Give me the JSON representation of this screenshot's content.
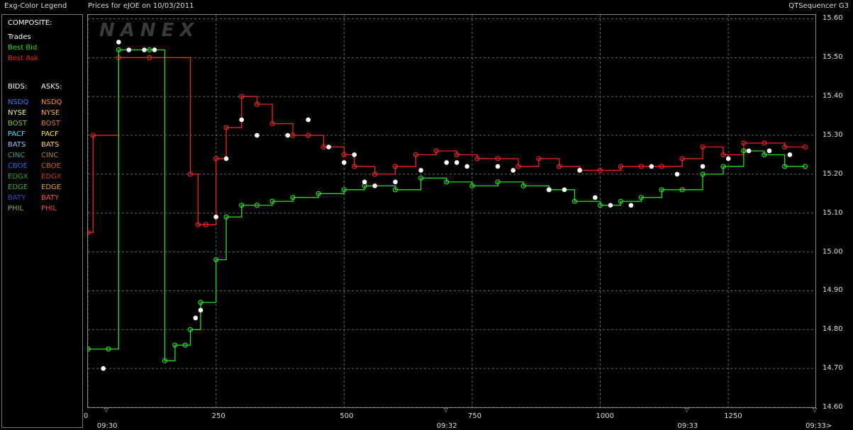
{
  "header": {
    "legend_title": "Exg-Color Legend",
    "chart_title": "Prices for  eJOE  on  10/03/2011",
    "app_name": "QTSequencer G3"
  },
  "legend": {
    "composite_label": "COMPOSITE:",
    "trades": "Trades",
    "best_bid": "Best Bid",
    "best_ask": "Best Ask",
    "bids_label": "BIDS:",
    "asks_label": "ASKS:",
    "exchanges": [
      {
        "name": "NSDQ",
        "bid_color": "#3a7bff",
        "ask_color": "#ff8c2a"
      },
      {
        "name": "NYSE",
        "bid_color": "#f4f4a0",
        "ask_color": "#ffb030"
      },
      {
        "name": "BOST",
        "bid_color": "#7cc84a",
        "ask_color": "#e07a3a"
      },
      {
        "name": "PACF",
        "bid_color": "#40e0ff",
        "ask_color": "#ffe040"
      },
      {
        "name": "BATS",
        "bid_color": "#a0c0ff",
        "ask_color": "#ffcc60"
      },
      {
        "name": "CINC",
        "bid_color": "#2aa0a0",
        "ask_color": "#b08030"
      },
      {
        "name": "CBOE",
        "bid_color": "#2070e0",
        "ask_color": "#d06020"
      },
      {
        "name": "EDGX",
        "bid_color": "#3a9a3a",
        "ask_color": "#c04010"
      },
      {
        "name": "EDGE",
        "bid_color": "#4aa04a",
        "ask_color": "#e0a020"
      },
      {
        "name": "BATY",
        "bid_color": "#3050c0",
        "ask_color": "#ff5050"
      },
      {
        "name": "PHIL",
        "bid_color": "#80b040",
        "ask_color": "#ff4040"
      }
    ]
  },
  "watermark": "NANEX",
  "colors": {
    "trades": "#ffffff",
    "best_bid": "#22dd22",
    "best_ask": "#ee2222",
    "grid": "#666666"
  },
  "chart_data": {
    "type": "line",
    "title": "Prices for  eJOE  on  10/03/2011",
    "x_label": "",
    "y_label": "",
    "xlim": [
      0,
      1420
    ],
    "ylim": [
      14.6,
      15.61
    ],
    "y_ticks": [
      "15.60",
      "15.50",
      "15.40",
      "15.30",
      "15.20",
      "15.10",
      "15.00",
      "14.90",
      "14.80",
      "14.70",
      "14.60"
    ],
    "x_ticks": [
      "0",
      "250",
      "500",
      "750",
      "1000",
      "1250"
    ],
    "time_ticks": [
      {
        "label": "09:30",
        "x": 37
      },
      {
        "label": "09:32",
        "x": 700
      },
      {
        "label": "09:33",
        "x": 1170
      },
      {
        "label": "09:33>",
        "x": 1420
      }
    ],
    "grid": true,
    "series": [
      {
        "name": "Best Ask",
        "x": [
          0,
          10,
          60,
          120,
          200,
          215,
          230,
          250,
          270,
          300,
          330,
          360,
          400,
          430,
          460,
          500,
          520,
          560,
          600,
          640,
          680,
          720,
          760,
          800,
          840,
          880,
          920,
          960,
          1000,
          1040,
          1080,
          1120,
          1160,
          1200,
          1240,
          1280,
          1320,
          1360,
          1400
        ],
        "y": [
          15.05,
          15.3,
          15.5,
          15.5,
          15.2,
          15.07,
          15.07,
          15.24,
          15.32,
          15.4,
          15.38,
          15.33,
          15.3,
          15.3,
          15.27,
          15.25,
          15.22,
          15.2,
          15.22,
          15.25,
          15.26,
          15.25,
          15.24,
          15.24,
          15.22,
          15.24,
          15.22,
          15.21,
          15.21,
          15.22,
          15.22,
          15.22,
          15.24,
          15.27,
          15.25,
          15.28,
          15.28,
          15.27,
          15.27
        ]
      },
      {
        "name": "Best Bid",
        "x": [
          0,
          40,
          60,
          120,
          150,
          170,
          190,
          200,
          220,
          250,
          270,
          300,
          330,
          360,
          400,
          450,
          500,
          540,
          600,
          650,
          700,
          750,
          800,
          850,
          900,
          950,
          1000,
          1040,
          1080,
          1120,
          1160,
          1200,
          1240,
          1280,
          1320,
          1360,
          1400
        ],
        "y": [
          14.75,
          14.75,
          15.52,
          15.52,
          14.72,
          14.76,
          14.76,
          14.8,
          14.87,
          14.98,
          15.09,
          15.12,
          15.12,
          15.13,
          15.14,
          15.15,
          15.16,
          15.17,
          15.16,
          15.19,
          15.18,
          15.17,
          15.18,
          15.17,
          15.16,
          15.13,
          15.12,
          15.13,
          15.14,
          15.16,
          15.16,
          15.2,
          15.22,
          15.26,
          15.25,
          15.22,
          15.22
        ]
      },
      {
        "name": "Trades",
        "x": [
          30,
          60,
          80,
          110,
          130,
          210,
          220,
          250,
          270,
          300,
          330,
          390,
          430,
          470,
          500,
          520,
          540,
          560,
          600,
          650,
          700,
          720,
          740,
          800,
          830,
          900,
          930,
          960,
          990,
          1020,
          1060,
          1100,
          1150,
          1200,
          1250,
          1290,
          1330,
          1370
        ],
        "y": [
          14.7,
          15.54,
          15.52,
          15.52,
          15.52,
          14.83,
          14.85,
          15.09,
          15.24,
          15.34,
          15.3,
          15.3,
          15.34,
          15.27,
          15.23,
          15.25,
          15.18,
          15.17,
          15.18,
          15.21,
          15.23,
          15.23,
          15.22,
          15.22,
          15.21,
          15.16,
          15.16,
          15.21,
          15.14,
          15.12,
          15.12,
          15.22,
          15.2,
          15.22,
          15.24,
          15.26,
          15.26,
          15.25
        ]
      }
    ]
  }
}
